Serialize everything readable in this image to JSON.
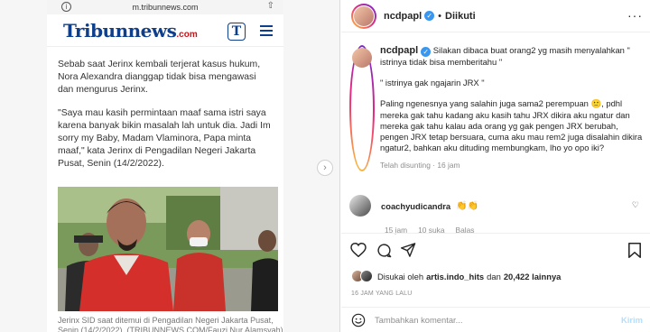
{
  "article": {
    "url": "m.tribunnews.com",
    "logo_main": "Tribunnews",
    "logo_domain": ".com",
    "ghost_text": "...",
    "badge": "T",
    "paragraph1": "Sebab saat Jerinx kembali terjerat kasus hukum, Nora Alexandra dianggap tidak bisa mengawasi dan mengurus Jerinx.",
    "paragraph2": "\"Saya mau kasih permintaan maaf sama istri saya karena banyak bikin masalah lah untuk dia. Jadi Im sorry my Baby, Madam Vlaminora, Papa minta maaf,\" kata Jerinx di Pengadilan Negeri Jakarta Pusat, Senin (14/2/2022).",
    "caption": "Jerinx SID saat ditemui di Pengadilan Negeri Jakarta Pusat, Senin (14/2/2022). (TRIBUNNEWS.COM/Fauzi Nur Alamsyah)"
  },
  "post": {
    "username": "ncdpapl",
    "follow_status": "Diikuti",
    "caption_user": "ncdpapl",
    "caption_lines": [
      "Silakan dibaca buat orang2 yg masih menyalahkan \"",
      "istrinya tidak bisa memberitahu \""
    ],
    "caption_quote": "\" istrinya gak ngajarin JRX \"",
    "caption_body": [
      "Paling ngenesnya yang salahin juga sama2 perempuan 🙂, pdhl",
      "mereka gak tahu kadang aku kasih tahu JRX dikira aku ngatur dan",
      "mereka gak tahu kalau ada orang yg gak pengen JRX berubah,",
      "pengen JRX tetap bersuara, cuma aku mau rem2 juga disalahin dikira",
      "ngatur2, bahkan aku dituding membungkam, lho yo opo iki?"
    ],
    "edited": "Telah disunting · 16 jam",
    "comment": {
      "user": "coachyudicandra",
      "text": "👏👏",
      "time": "15 jam",
      "likes": "10 suka",
      "reply": "Balas"
    },
    "liked_prefix": "Disukai oleh",
    "liked_user": "artis.indo_hits",
    "liked_mid": "dan",
    "liked_count": "20,422 lainnya",
    "posted_ago": "16 JAM YANG LALU",
    "add_comment_placeholder": "Tambahkan komentar...",
    "send_label": "Kirim"
  },
  "colors": {
    "link_blue": "#3897f0",
    "send_disabled": "#b2dffc",
    "tribun_blue": "#0d3f8c",
    "tribun_red": "#c4161c"
  }
}
